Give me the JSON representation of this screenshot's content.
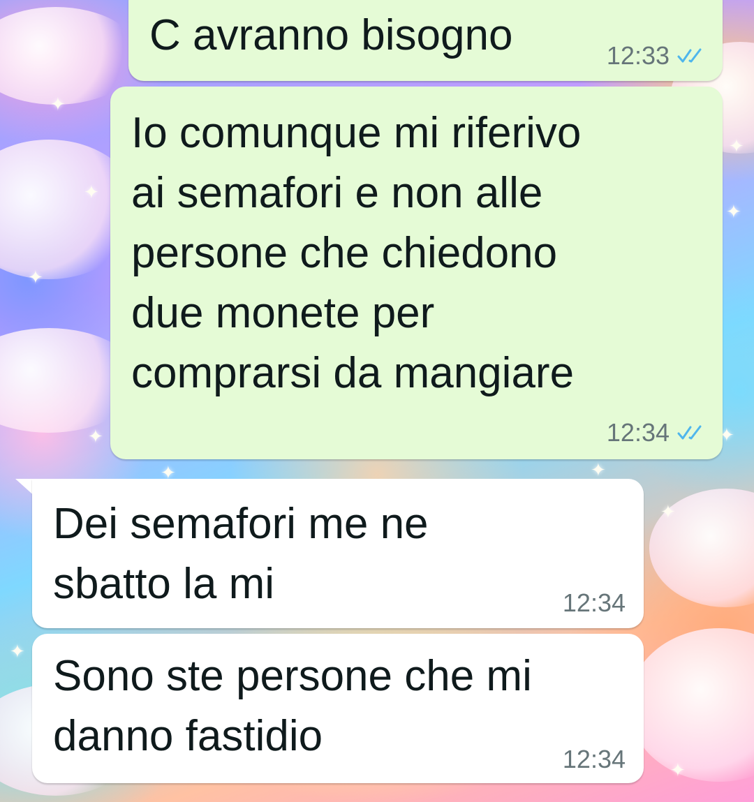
{
  "colors": {
    "outgoing_bubble": "#e5fbd6",
    "incoming_bubble": "#ffffff",
    "read_ticks": "#4fb6ec",
    "timestamp": "#667579",
    "text": "#0f1a1c"
  },
  "messages": [
    {
      "direction": "outgoing",
      "text": "C avranno bisogno",
      "time": "12:33",
      "status": "read",
      "status_icon": "double-check-icon"
    },
    {
      "direction": "outgoing",
      "text": "Io comunque mi riferivo\nai semafori e non alle\npersone che chiedono\ndue monete per\ncomprarsi da mangiare",
      "time": "12:34",
      "status": "read",
      "status_icon": "double-check-icon"
    },
    {
      "direction": "incoming",
      "text": "Dei semafori me ne\nsbatto la mi",
      "time": "12:34"
    },
    {
      "direction": "incoming",
      "text": "Sono ste persone che mi\ndanno fastidio",
      "time": "12:34"
    }
  ]
}
